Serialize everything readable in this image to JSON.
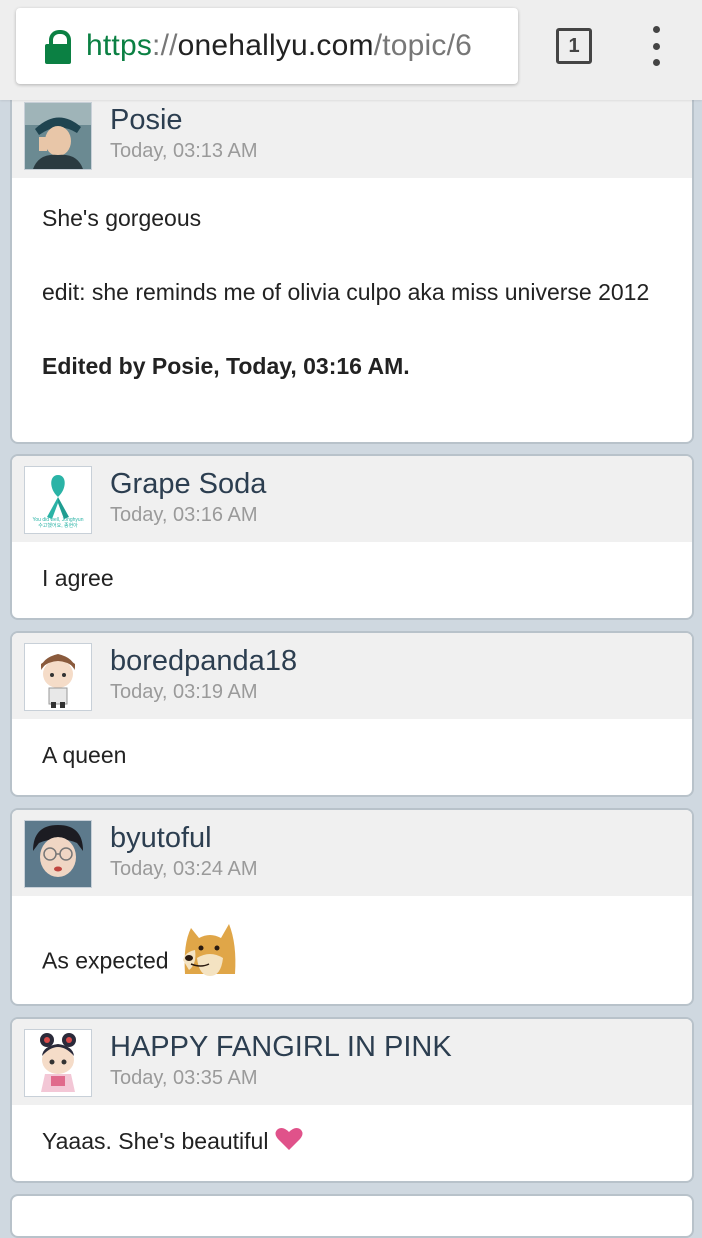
{
  "browser": {
    "url_scheme": "https",
    "url_separator": "://",
    "url_host": "onehallyu.com",
    "url_path": "/topic/6",
    "tab_count": "1",
    "lock_icon": "lock-icon",
    "menu_icon": "overflow-menu-icon"
  },
  "colors": {
    "secure_green": "#0b8043",
    "username_blue": "#2c3e50",
    "header_gray": "#f0f0f0",
    "page_bg": "#cfd8e0",
    "heart_pink": "#e0528a"
  },
  "posts": [
    {
      "username": "Posie",
      "timestamp": "Today, 03:13 AM",
      "lines": [
        "She's gorgeous",
        "edit: she reminds me of olivia culpo aka miss universe 2012"
      ],
      "edited_note": "Edited by Posie, Today, 03:16 AM."
    },
    {
      "username": "Grape Soda",
      "timestamp": "Today, 03:16 AM",
      "lines": [
        "I agree"
      ],
      "avatar_caption": "You did well, Jonghyun",
      "avatar_caption_korean": "수고했어요, 종현아"
    },
    {
      "username": "boredpanda18",
      "timestamp": "Today, 03:19 AM",
      "lines": [
        "A queen"
      ]
    },
    {
      "username": "byutoful",
      "timestamp": "Today, 03:24 AM",
      "lines": [
        "As expected"
      ],
      "emoji": "doge-emoji"
    },
    {
      "username": "HAPPY FANGIRL IN PINK",
      "timestamp": "Today, 03:35 AM",
      "lines": [
        "Yaaas. She's beautiful"
      ],
      "emoji": "heart-icon"
    }
  ]
}
